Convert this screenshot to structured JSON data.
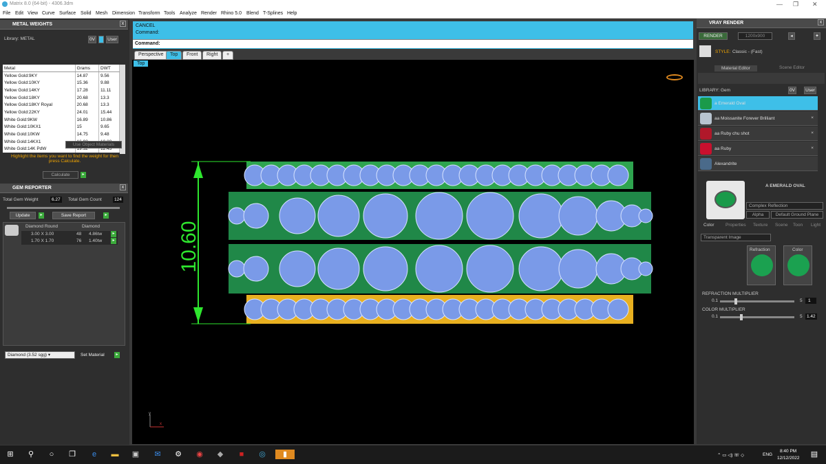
{
  "window": {
    "title": "Matrix 8.0 (64-bit) - 4306.3dm"
  },
  "menu": [
    "File",
    "Edit",
    "View",
    "Curve",
    "Surface",
    "Solid",
    "Mesh",
    "Dimension",
    "Transform",
    "Tools",
    "Analyze",
    "Render",
    "Rhino 5.0",
    "Blend",
    "T-Splines",
    "Help"
  ],
  "metal": {
    "title": "METAL WEIGHTS",
    "library": "Library: METAL",
    "btn_0v": "0V",
    "btn_user": "User",
    "headers": [
      "Metal",
      "Grams",
      "DWT"
    ],
    "rows": [
      [
        "Yellow Gold:9KY",
        "14.87",
        "9.56"
      ],
      [
        "Yellow Gold:10KY",
        "15.36",
        "9.88"
      ],
      [
        "Yellow Gold:14KY",
        "17.28",
        "11.11"
      ],
      [
        "Yellow Gold:18KY",
        "20.68",
        "13.3"
      ],
      [
        "Yellow Gold:18KY Royal",
        "20.68",
        "13.3"
      ],
      [
        "Yellow Gold:22KY",
        "24.01",
        "15.44"
      ],
      [
        "White Gold:9KW",
        "16.89",
        "10.86"
      ],
      [
        "White Gold:10KX1",
        "15",
        "9.65"
      ],
      [
        "White Gold:10KW",
        "14.75",
        "9.48"
      ],
      [
        "White Gold:14KX1",
        "16.92",
        "10.88"
      ],
      [
        "White Gold:14K PdW",
        "19.32",
        "12.43"
      ]
    ],
    "use_object": "Use Object Materials",
    "hint": "Highlight the items you want to find the weight for then press Calculate.",
    "calculate": "Calculate"
  },
  "gem": {
    "title": "GEM REPORTER",
    "total_weight_label": "Total Gem Weight",
    "total_weight": "6.27",
    "total_count_label": "Total Gem Count",
    "total_count": "124",
    "update": "Update",
    "save_report": "Save Report",
    "headers": [
      "Diamond Round",
      "Diamond"
    ],
    "rows": [
      [
        "3.00 X 3.00",
        "48",
        "4.86tw"
      ],
      [
        "1.70 X 1.70",
        "76",
        "1.40tw"
      ]
    ],
    "material": "Diamond",
    "sg": "(3.52 sgg)",
    "set_material": "Set Material"
  },
  "command": {
    "line1": "CANCEL",
    "line2": "Command:",
    "prompt": "Command:"
  },
  "tabs": [
    "Perspective",
    "Top",
    "Front",
    "Right",
    "+"
  ],
  "viewport": {
    "label": "Top",
    "dimension": "10.60",
    "axis_y": "y",
    "axis_x": "x"
  },
  "vray": {
    "title": "VRAY RENDER",
    "render": "RENDER",
    "resolution": "1200x900",
    "style_label": "STYLE:",
    "style": "Classic - (Fast)",
    "tabs": [
      "Material Editor",
      "Scene Editor"
    ],
    "library": "LIBRARY: Gem",
    "btn_0v": "0V",
    "btn_user": "User",
    "materials": [
      {
        "name": "a Emerald Oval",
        "color": "#1a9a4a"
      },
      {
        "name": "aa Moissanite Forever Brilliant",
        "color": "#b8c4d0"
      },
      {
        "name": "aa Ruby chu shot",
        "color": "#b0182a"
      },
      {
        "name": "aa Ruby",
        "color": "#c8102e"
      },
      {
        "name": "Alexandrite",
        "color": "#4a6a8a"
      }
    ],
    "selected_name": "A EMERALD OVAL",
    "type": "Complex Reflection",
    "alpha": "Alpha",
    "ground": "Default Ground Plane",
    "subtabs": [
      "Color",
      "Properties",
      "Texture",
      "Scene",
      "Toon",
      "Light"
    ],
    "transparent": "Transparent Image",
    "refraction": "Refraction",
    "color": "Color",
    "refraction_mult": "REFRACTION MULTIPLIER",
    "color_mult": "COLOR MULTIPLIER",
    "min": "0.1",
    "max": "5",
    "refraction_value": "1",
    "color_value": "1.42",
    "refraction_level": 0.2,
    "color_level": 0.28
  },
  "taskbar": {
    "time": "8:40 PM",
    "date": "12/12/2022",
    "lang": "ENG"
  },
  "colors": {
    "accent": "#3ebfe8",
    "green": "#2ea44f",
    "gold": "#e8b020",
    "stone": "#7a9ae8"
  }
}
